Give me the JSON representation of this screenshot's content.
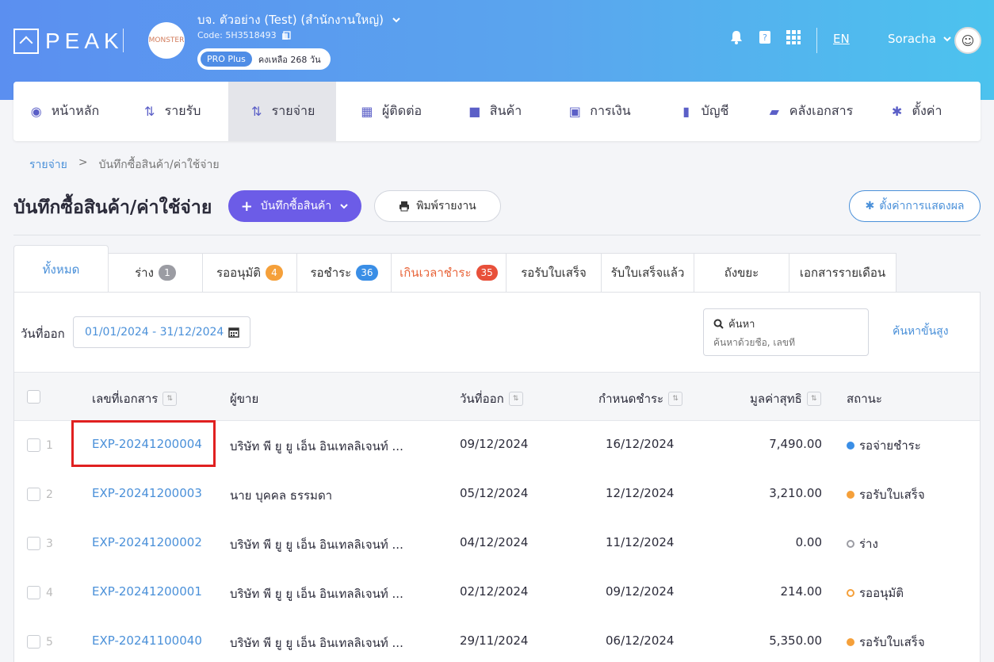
{
  "header": {
    "logo_text": "PEAK",
    "company_name": "บจ. ตัวอย่าง (Test) (สำนักงานใหญ่)",
    "company_avatar_text": "MONSTER",
    "company_code": "Code: 5H3518493",
    "plan_badge": "PRO Plus",
    "plan_days": "คงเหลือ 268 วัน",
    "lang": "EN",
    "user_name": "Soracha"
  },
  "nav": {
    "items": [
      {
        "label": "หน้าหลัก",
        "icon": "dashboard-icon"
      },
      {
        "label": "รายรับ",
        "icon": "income-icon"
      },
      {
        "label": "รายจ่าย",
        "icon": "expense-icon"
      },
      {
        "label": "ผู้ติดต่อ",
        "icon": "contacts-icon"
      },
      {
        "label": "สินค้า",
        "icon": "box-icon"
      },
      {
        "label": "การเงิน",
        "icon": "money-icon"
      },
      {
        "label": "บัญชี",
        "icon": "book-icon"
      },
      {
        "label": "คลังเอกสาร",
        "icon": "folder-icon"
      },
      {
        "label": "ตั้งค่า",
        "icon": "gear-icon"
      }
    ]
  },
  "breadcrumb": {
    "parent": "รายจ่าย",
    "separator": ">",
    "current": "บันทึกซื้อสินค้า/ค่าใช้จ่าย"
  },
  "page": {
    "title": "บันทึกซื้อสินค้า/ค่าใช้จ่าย",
    "add_button": "บันทึกซื้อสินค้า",
    "print_button": "พิมพ์รายงาน",
    "settings_button": "ตั้งค่าการแสดงผล"
  },
  "tabs": [
    {
      "label": "ทั้งหมด",
      "count": ""
    },
    {
      "label": "ร่าง",
      "count": "1"
    },
    {
      "label": "รออนุมัติ",
      "count": "4"
    },
    {
      "label": "รอชำระ",
      "count": "36"
    },
    {
      "label": "เกินเวลาชำระ",
      "count": "35"
    },
    {
      "label": "รอรับใบเสร็จ",
      "count": ""
    },
    {
      "label": "รับใบเสร็จแล้ว",
      "count": ""
    },
    {
      "label": "ถังขยะ",
      "count": ""
    },
    {
      "label": "เอกสารรายเดือน",
      "count": ""
    }
  ],
  "filter": {
    "date_label": "วันที่ออก",
    "date_range": "01/01/2024 - 31/12/2024",
    "search_label": "ค้นหา",
    "search_placeholder": "ค้นหาด้วยชื่อ, เลขที่",
    "advanced_search": "ค้นหาขั้นสูง"
  },
  "table": {
    "columns": {
      "doc_no": "เลขที่เอกสาร",
      "vendor": "ผู้ขาย",
      "issue_date": "วันที่ออก",
      "due_date": "กำหนดชำระ",
      "net_value": "มูลค่าสุทธิ",
      "status": "สถานะ"
    },
    "rows": [
      {
        "num": "1",
        "doc_no": "EXP-20241200004",
        "vendor": "บริษัท พี ยู ยู เอ็น อินเทลลิเจนท์ ...",
        "issue_date": "09/12/2024",
        "due_date": "16/12/2024",
        "net_value": "7,490.00",
        "status": "รอจ่ายชำระ"
      },
      {
        "num": "2",
        "doc_no": "EXP-20241200003",
        "vendor": "นาย บุคคล ธรรมดา",
        "issue_date": "05/12/2024",
        "due_date": "12/12/2024",
        "net_value": "3,210.00",
        "status": "รอรับใบเสร็จ"
      },
      {
        "num": "3",
        "doc_no": "EXP-20241200002",
        "vendor": "บริษัท พี ยู ยู เอ็น อินเทลลิเจนท์ ...",
        "issue_date": "04/12/2024",
        "due_date": "11/12/2024",
        "net_value": "0.00",
        "status": "ร่าง"
      },
      {
        "num": "4",
        "doc_no": "EXP-20241200001",
        "vendor": "บริษัท พี ยู ยู เอ็น อินเทลลิเจนท์ ...",
        "issue_date": "02/12/2024",
        "due_date": "09/12/2024",
        "net_value": "214.00",
        "status": "รออนุมัติ"
      },
      {
        "num": "5",
        "doc_no": "EXP-20241100040",
        "vendor": "บริษัท พี ยู ยู เอ็น อินเทลลิเจนท์ ...",
        "issue_date": "29/11/2024",
        "due_date": "06/12/2024",
        "net_value": "5,350.00",
        "status": "รอรับใบเสร็จ"
      }
    ]
  },
  "colors": {
    "primary": "#6c5ce7",
    "link": "#4a90d9",
    "badge_draft": "#9b9ca3",
    "badge_approval": "#f5a03a",
    "badge_payment": "#3a8ee6",
    "badge_overdue": "#e8503a",
    "highlight": "#e02020"
  }
}
